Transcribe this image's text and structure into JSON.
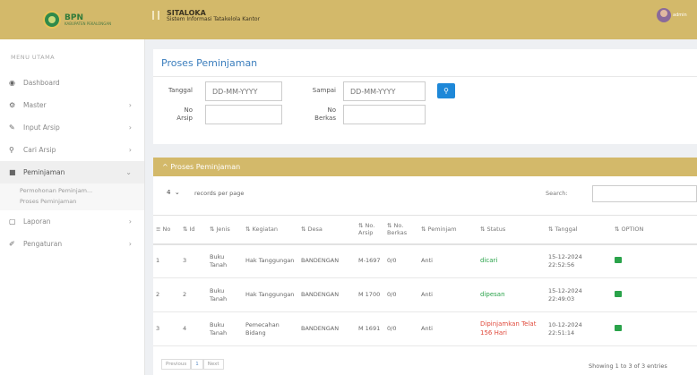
{
  "brand": {
    "line1": "BPN",
    "line2": "KABUPATEN PEKALONGAN"
  },
  "header": {
    "title": "SITALOKA",
    "subtitle": "Sistem Informasi Tatakelola Kantor",
    "user": "admin"
  },
  "sidebar": {
    "section": "MENU UTAMA",
    "items": [
      {
        "label": "Dashboard",
        "icon": "dashboard-icon",
        "chev": ""
      },
      {
        "label": "Master",
        "icon": "master-icon",
        "chev": "›"
      },
      {
        "label": "Input Arsip",
        "icon": "pen-icon",
        "chev": "›"
      },
      {
        "label": "Cari Arsip",
        "icon": "search-icon",
        "chev": "›"
      },
      {
        "label": "Peminjaman",
        "icon": "book-icon",
        "chev": "⌄"
      },
      {
        "label": "Laporan",
        "icon": "file-icon",
        "chev": "›"
      },
      {
        "label": "Pengaturan",
        "icon": "wrench-icon",
        "chev": "›"
      }
    ],
    "subitems": [
      "Permohonan Peminjam...",
      "Proses Peminjaman"
    ]
  },
  "filter": {
    "title": "Proses Peminjaman",
    "tanggal_label": "Tanggal",
    "tanggal_placeholder": "DD-MM-YYYY",
    "sampai_label": "Sampai",
    "sampai_placeholder": "DD-MM-YYYY",
    "no_arsip_label_1": "No",
    "no_arsip_label_2": "Arsip",
    "no_berkas_label_1": "No",
    "no_berkas_label_2": "Berkas"
  },
  "panel": {
    "title": "^ Proses Peminjaman",
    "length_value": "4",
    "length_text": "records per page",
    "search_label": "Search:",
    "columns": [
      {
        "label": "≡ No"
      },
      {
        "label": "⇅ Id"
      },
      {
        "label": "⇅ Jenis"
      },
      {
        "label": "⇅ Kegiatan"
      },
      {
        "label": "⇅ Desa"
      },
      {
        "label": "⇅ No. Arsip"
      },
      {
        "label": "⇅ No. Berkas"
      },
      {
        "label": "⇅ Peminjam"
      },
      {
        "label": "⇅ Status"
      },
      {
        "label": "⇅ Tanggal"
      },
      {
        "label": "⇅ OPTION"
      }
    ],
    "rows": [
      {
        "no": "1",
        "id": "3",
        "jenis": "Buku Tanah",
        "kegiatan": "Hak Tanggungan",
        "desa": "BANDENGAN",
        "no_arsip": "M-1697",
        "no_berkas": "0/0",
        "peminjam": "Anti",
        "status": "dicari",
        "status_color": "green",
        "tanggal": "15-12-2024 22:52:56"
      },
      {
        "no": "2",
        "id": "2",
        "jenis": "Buku Tanah",
        "kegiatan": "Hak Tanggungan",
        "desa": "BANDENGAN",
        "no_arsip": "M 1700",
        "no_berkas": "0/0",
        "peminjam": "Anti",
        "status": "dipesan",
        "status_color": "green",
        "tanggal": "15-12-2024 22:49:03"
      },
      {
        "no": "3",
        "id": "4",
        "jenis": "Buku Tanah",
        "kegiatan": "Pemecahan Bidang",
        "desa": "BANDENGAN",
        "no_arsip": "M 1691",
        "no_berkas": "0/0",
        "peminjam": "Anti",
        "status": "Dipinjamkan Telat 156 Hari",
        "status_color": "red",
        "tanggal": "10-12-2024 22:51:14"
      }
    ],
    "pager": {
      "prev": "Previous",
      "page": "1",
      "next": "Next"
    },
    "info": "Showing 1 to 3 of 3 entries"
  }
}
